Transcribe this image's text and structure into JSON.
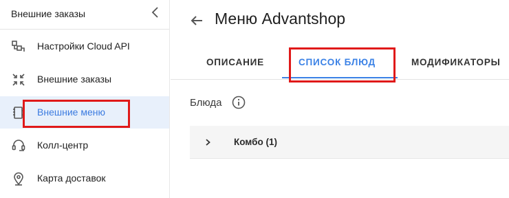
{
  "sidebar": {
    "title": "Внешние заказы",
    "items": [
      {
        "label": "Настройки Cloud API",
        "icon": "cloud-api-icon"
      },
      {
        "label": "Внешние заказы",
        "icon": "shrink-arrows-icon"
      },
      {
        "label": "Внешние меню",
        "icon": "notebook-icon",
        "active": true
      },
      {
        "label": "Колл-центр",
        "icon": "headset-icon"
      },
      {
        "label": "Карта доставок",
        "icon": "map-pin-icon"
      }
    ]
  },
  "header": {
    "title": "Меню Advantshop"
  },
  "tabs": [
    {
      "label": "Описание"
    },
    {
      "label": "Список блюд",
      "active": true
    },
    {
      "label": "Модификаторы"
    }
  ],
  "main": {
    "section_label": "Блюда",
    "groups": [
      {
        "label": "Комбо (1)"
      }
    ]
  },
  "colors": {
    "accent": "#3b82e6",
    "active_bg": "#e8f0fb",
    "highlight_box": "#e01919"
  }
}
